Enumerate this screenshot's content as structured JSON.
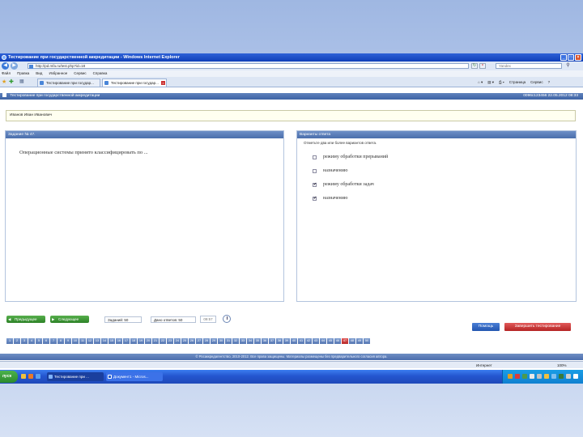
{
  "window": {
    "title": "Тестирование при государственной аккредитации - Windows Internet Explorer"
  },
  "address": {
    "url": "http://pd.mfa.ru/test.php?id=18",
    "search_placeholder": "Yandex"
  },
  "menu": [
    "Файл",
    "Правка",
    "Вид",
    "Избранное",
    "Сервис",
    "Справка"
  ],
  "tabs": [
    {
      "label": "Тестирование при государ..."
    },
    {
      "label": "Тестирование при государ..."
    }
  ],
  "commands": [
    "Страница",
    "Сервис"
  ],
  "app": {
    "header_title": "Тестирование при государственной аккредитации",
    "user_info": "0096c123456 22.05.2012 08:33",
    "student_label": "Иванов Иван Иванович",
    "footer_text": "© Росаккредагентство, 2010-2012. Все права защищены. Материалы размещены без предварительного согласия автора."
  },
  "question": {
    "panel_title": "Задание № 47.",
    "text": "Операционные системы принято классифицировать по ..."
  },
  "answers": {
    "panel_title": "Варианты ответа",
    "hint": "Отметьте два или более вариантов ответа.",
    "options": [
      {
        "label": "режиму обработки прерываний",
        "checked": false
      },
      {
        "label": "назначению",
        "checked": false
      },
      {
        "label": "режиму обработки задач",
        "checked": true
      },
      {
        "label": "назначению",
        "checked": true
      }
    ]
  },
  "navigation": {
    "prev_label": "Предыдущее",
    "next_label": "Следующее",
    "total_label": "Заданий: 50",
    "answered_label": "Дано ответов: 50",
    "timer": "09:57",
    "help_label": "Помощь",
    "finish_label": "Завершить тестирование"
  },
  "question_numbers": [
    "1",
    "2",
    "3",
    "4",
    "5",
    "6",
    "7",
    "8",
    "9",
    "10",
    "11",
    "12",
    "13",
    "14",
    "15",
    "16",
    "17",
    "18",
    "19",
    "20",
    "21",
    "22",
    "23",
    "24",
    "25",
    "26",
    "27",
    "28",
    "29",
    "30",
    "31",
    "32",
    "33",
    "34",
    "35",
    "36",
    "37",
    "38",
    "39",
    "40",
    "41",
    "42",
    "43",
    "44",
    "45",
    "46",
    "47",
    "48",
    "49",
    "50"
  ],
  "current_question": "47",
  "status": {
    "zone": "Интернет",
    "zoom": "100%"
  },
  "taskbar": {
    "start_label": "пуск",
    "tasks": [
      {
        "label": "Тестирование при ..."
      },
      {
        "label": "Документ1 - Micros..."
      }
    ]
  },
  "colors": {
    "header_blue": "#4a6eab",
    "nav_green": "#2d8227",
    "finish_red": "#b52424",
    "help_blue": "#2356b0"
  }
}
